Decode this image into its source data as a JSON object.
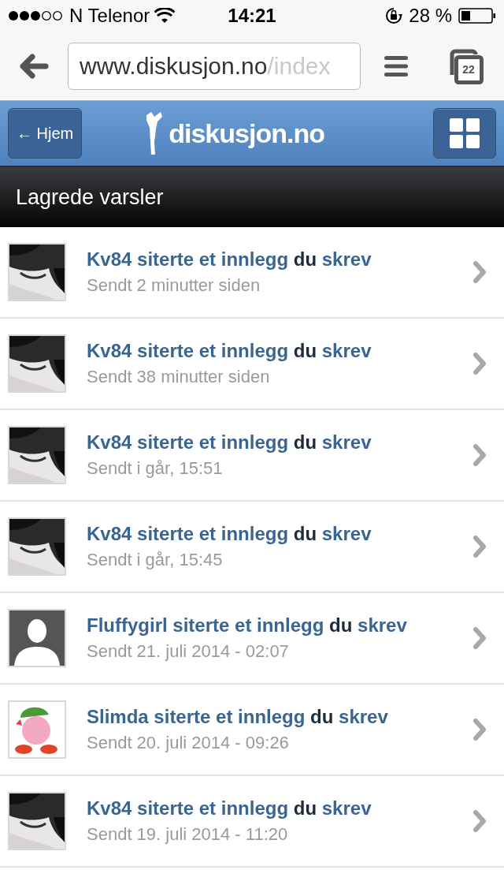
{
  "status_bar": {
    "carrier": "N Telenor",
    "time": "14:21",
    "battery": "28 %"
  },
  "browser": {
    "url_host": "www.diskusjon.no",
    "url_path": "/index",
    "tab_count": "22"
  },
  "header": {
    "back_button": "← Hjem",
    "logo_text": "diskusjon.no"
  },
  "page_title": "Lagrede varsler",
  "alerts": [
    {
      "author_link": "Kv84 siterte et innlegg",
      "middle": "du",
      "end_link": "skrev",
      "time": "Sendt 2 minutter siden"
    },
    {
      "author_link": "Kv84 siterte et innlegg",
      "middle": "du",
      "end_link": "skrev",
      "time": "Sendt 38 minutter siden"
    },
    {
      "author_link": "Kv84 siterte et innlegg",
      "middle": "du",
      "end_link": "skrev",
      "time": "Sendt i går, 15:51"
    },
    {
      "author_link": "Kv84 siterte et innlegg",
      "middle": "du",
      "end_link": "skrev",
      "time": "Sendt i går, 15:45"
    },
    {
      "avatar": {
        "kind": "silhouette"
      },
      "author_link": "Fluffygirl siterte et innlegg",
      "middle": "du",
      "end_link": "skrev",
      "time": "Sendt 21. juli 2014 - 02:07"
    },
    {
      "avatar": {
        "kind": "cartoon"
      },
      "author_link": "Slimda siterte et innlegg",
      "middle": "du",
      "end_link": "skrev",
      "time": "Sendt 20. juli 2014 - 09:26"
    },
    {
      "author_link": "Kv84 siterte et innlegg",
      "middle": "du",
      "end_link": "skrev",
      "time": "Sendt 19. juli 2014 - 11:20"
    }
  ]
}
